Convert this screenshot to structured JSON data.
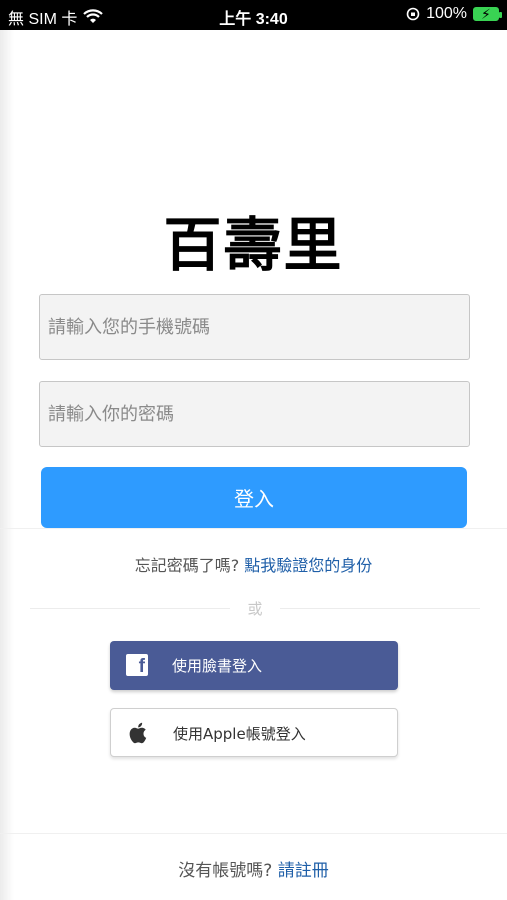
{
  "status_bar": {
    "carrier": "無 SIM 卡",
    "time": "上午 3:40",
    "battery_percent": "100%",
    "battery_color": "#39d353"
  },
  "app_title": "百壽里",
  "login_form": {
    "phone_placeholder": "請輸入您的手機號碼",
    "phone_value": "",
    "password_placeholder": "請輸入你的密碼",
    "password_value": "",
    "login_label": "登入",
    "login_color": "#2e9bff"
  },
  "forgot": {
    "prompt": "忘記密碼了嗎?",
    "link": "點我驗證您的身份"
  },
  "or_label": "或",
  "social": {
    "facebook_label": "使用臉書登入",
    "facebook_color": "#4a5b96",
    "apple_label": "使用Apple帳號登入"
  },
  "signup": {
    "prompt": "沒有帳號嗎?",
    "link": "請註冊"
  }
}
